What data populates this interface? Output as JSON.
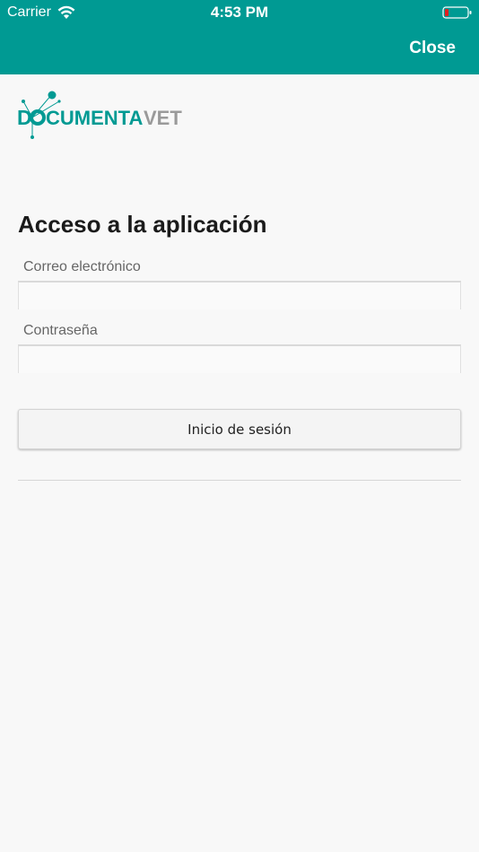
{
  "status_bar": {
    "carrier": "Carrier",
    "time": "4:53 PM"
  },
  "nav": {
    "close_label": "Close"
  },
  "logo": {
    "text_part1": "D",
    "text_part2": "CUMENTA",
    "text_part3": "VET"
  },
  "form": {
    "title": "Acceso a la aplicación",
    "email_label": "Correo electrónico",
    "email_value": "",
    "password_label": "Contraseña",
    "password_value": "",
    "submit_label": "Inicio de sesión"
  },
  "colors": {
    "brand": "#009a93",
    "logo_gray": "#9a9a9a",
    "battery_low": "#e02020"
  }
}
